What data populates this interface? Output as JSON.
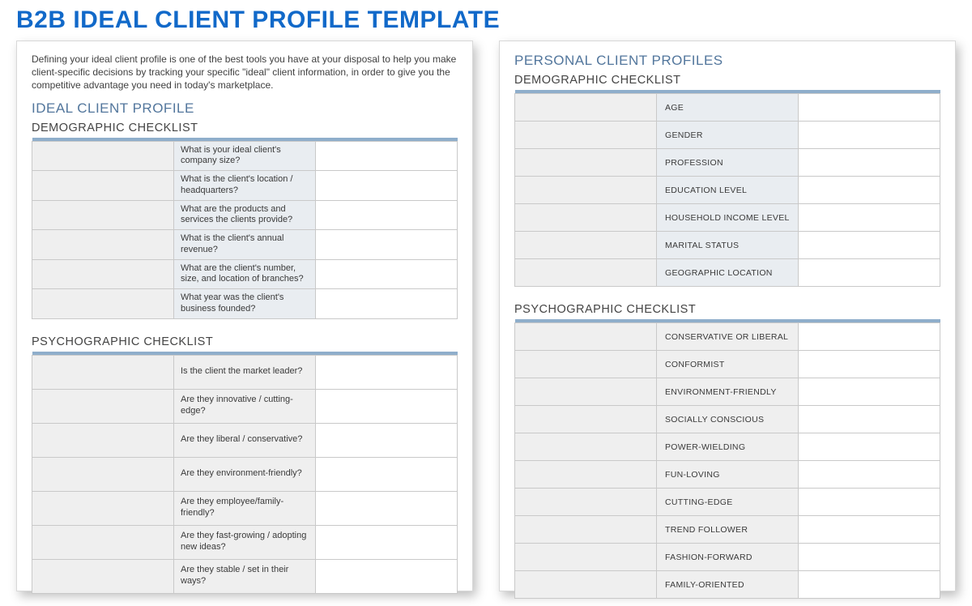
{
  "page_title": "B2B IDEAL CLIENT PROFILE TEMPLATE",
  "intro": "Defining your ideal client profile is one of the best tools you have at your disposal to help you make client-specific decisions by tracking your specific \"ideal\" client information, in order to give you the competitive advantage you need in today's marketplace.",
  "left": {
    "section_title": "IDEAL CLIENT PROFILE",
    "demo_heading": "DEMOGRAPHIC CHECKLIST",
    "demo_rows": [
      "What is your ideal client's company size?",
      "What is the client's location / headquarters?",
      "What are the products and services the clients provide?",
      "What is the client's annual revenue?",
      "What are the client's number, size, and location of branches?",
      "What year was the client's business founded?"
    ],
    "psy_heading": "PSYCHOGRAPHIC CHECKLIST",
    "psy_rows": [
      "Is the client the market leader?",
      "Are they innovative / cutting-edge?",
      "Are they liberal / conservative?",
      "Are they environment-friendly?",
      "Are they employee/family-friendly?",
      "Are they fast-growing / adopting new ideas?",
      "Are they stable / set in their ways?"
    ]
  },
  "right": {
    "section_title": "PERSONAL CLIENT PROFILES",
    "demo_heading": "DEMOGRAPHIC CHECKLIST",
    "demo_rows": [
      "AGE",
      "GENDER",
      "PROFESSION",
      "EDUCATION LEVEL",
      "HOUSEHOLD INCOME LEVEL",
      "MARITAL STATUS",
      "GEOGRAPHIC LOCATION"
    ],
    "psy_heading": "PSYCHOGRAPHIC CHECKLIST",
    "psy_rows": [
      "CONSERVATIVE OR LIBERAL",
      "CONFORMIST",
      "ENVIRONMENT-FRIENDLY",
      "SOCIALLY CONSCIOUS",
      "POWER-WIELDING",
      "FUN-LOVING",
      "CUTTING-EDGE",
      "TREND FOLLOWER",
      "FASHION-FORWARD",
      "FAMILY-ORIENTED"
    ]
  }
}
